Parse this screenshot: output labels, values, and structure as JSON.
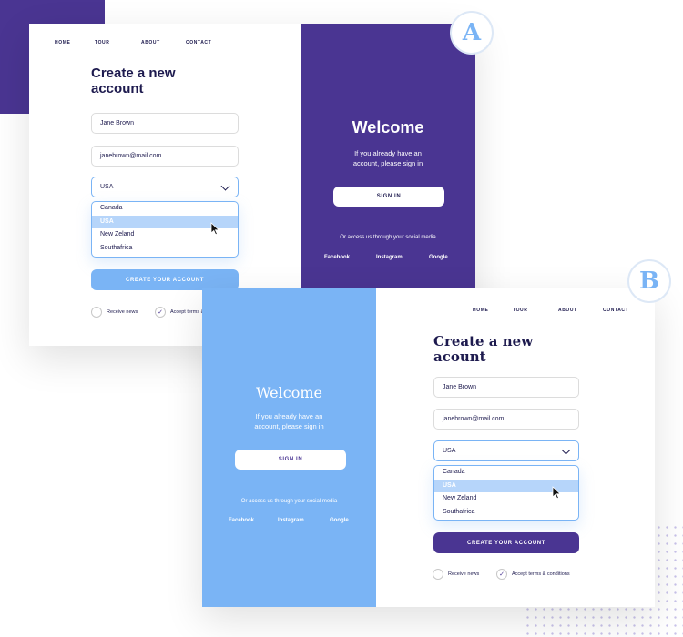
{
  "variant_a": {
    "badge": "A",
    "nav": [
      "HOME",
      "TOUR",
      "ABOUT",
      "CONTACT"
    ],
    "title_line1": "Create a new",
    "title_line2": "account",
    "name_value": "Jane Brown",
    "email_value": "janebrown@mail.com",
    "country_selected": "USA",
    "country_options": [
      "Canada",
      "USA",
      "New Zeland",
      "Southafrica"
    ],
    "create_button": "CREATE YOUR ACCOUNT",
    "receive_news": "Receive news",
    "accept_terms": "Accept terms & conditions",
    "welcome_title": "Welcome",
    "welcome_line1": "If you already have an",
    "welcome_line2": "account, please sign in",
    "sign_in": "SIGN IN",
    "social_prompt": "Or access us through your social media",
    "social": [
      "Facebook",
      "Instagram",
      "Google"
    ],
    "colors": {
      "panel": "#4a3592",
      "button": "#7ab4f5"
    }
  },
  "variant_b": {
    "badge": "B",
    "nav": [
      "HOME",
      "TOUR",
      "ABOUT",
      "CONTACT"
    ],
    "title_line1": "Create a new",
    "title_line2": "acount",
    "name_value": "Jane Brown",
    "email_value": "janebrown@mail.com",
    "country_selected": "USA",
    "country_options": [
      "Canada",
      "USA",
      "New Zeland",
      "Southafrica"
    ],
    "create_button": "CREATE YOUR ACCOUNT",
    "receive_news": "Receive news",
    "accept_terms": "Accept terms & conditions",
    "welcome_title": "Welcome",
    "welcome_line1": "If you already have an",
    "welcome_line2": "account, please sign in",
    "sign_in": "SIGN IN",
    "social_prompt": "Or access us through your social media",
    "social": [
      "Facebook",
      "Instagram",
      "Google"
    ],
    "colors": {
      "panel": "#7ab4f5",
      "button": "#4a3592"
    }
  }
}
